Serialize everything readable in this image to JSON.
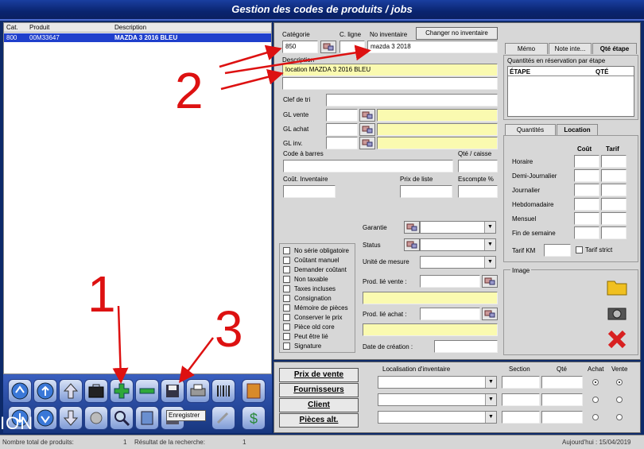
{
  "window": {
    "title": "Gestion des codes de produits / jobs"
  },
  "list": {
    "headers": [
      "Cat.",
      "Produit",
      "Description"
    ],
    "rows": [
      {
        "cat": "800",
        "produit": "00M33647",
        "description": "MAZDA 3 2016 BLEU"
      }
    ]
  },
  "toolbar": {
    "buttons_row1": [
      "nav-first-icon",
      "nav-prev-icon",
      "arrow-up-icon",
      "briefcase-icon",
      "add-icon",
      "remove-icon",
      "save-icon",
      "print-icon",
      "barcode-icon",
      "exit-icon"
    ],
    "buttons_row2": [
      "nav-next-icon",
      "nav-last-icon",
      "arrow-down-icon",
      "attach-icon",
      "search-icon",
      "book-icon",
      "save-disk-icon",
      "tools-icon",
      "money-icon"
    ],
    "save_tooltip": "Enregistrer"
  },
  "overlay_text": "ION",
  "form": {
    "categorie_label": "Catégorie",
    "categorie_value": "850",
    "cligne_label": "C. ligne",
    "noinv_label": "No inventaire",
    "noinv_value": "mazda 3 2018",
    "changer_btn": "Changer no inventaire",
    "description_label": "Description",
    "description_value": "location MAZDA 3 2016 BLEU",
    "clef_label": "Clef de tri",
    "glvente_label": "GL vente",
    "glachat_label": "GL achat",
    "glinv_label": "GL inv.",
    "codebarres_label": "Code à barres",
    "qtecaisse_label": "Qté / caisse",
    "cout_label": "Coût. Inventaire",
    "prixliste_label": "Prix de liste",
    "escompte_label": "Escompte %",
    "garantie_label": "Garantie",
    "status_label": "Status",
    "unite_label": "Unité de mesure",
    "prodvente_label": "Prod. lié vente :",
    "prodachat_label": "Prod. lié achat :",
    "datecreation_label": "Date de création :",
    "checkboxes": [
      "No série obligatoire",
      "Coûtant manuel",
      "Demander coûtant",
      "Non taxable",
      "Taxes incluses",
      "Consignation",
      "Mémoire de pièces",
      "Conserver le prix",
      "Pièce old core",
      "Peut être lié",
      "Signature"
    ]
  },
  "tabs_top": [
    "Mémo",
    "Note inte...",
    "Qté étape"
  ],
  "reservation": {
    "title": "Quantités en réservation par étape",
    "col1": "ÉTAPE",
    "col2": "QTÉ"
  },
  "tabs_mid": [
    "Quantités",
    "Location"
  ],
  "location": {
    "col_cout": "Coût",
    "col_tarif": "Tarif",
    "rows": [
      "Horaire",
      "Demi-Journalier",
      "Journalier",
      "Hebdomadaire",
      "Mensuel",
      "Fin de semaine"
    ],
    "tarif_km": "Tarif KM",
    "tarif_strict": "Tarif strict"
  },
  "image_label": "Image",
  "bottom": {
    "buttons": [
      "Prix de vente",
      "Fournisseurs",
      "Client",
      "Pièces alt."
    ],
    "col_localisation": "Localisation d'inventaire",
    "col_section": "Section",
    "col_qte": "Qté",
    "col_achat": "Achat",
    "col_vente": "Vente"
  },
  "status": {
    "nombre_label": "Nombre total de produits:",
    "nombre_value": "1",
    "resultat_label": "Résultat de la recherche:",
    "resultat_value": "1",
    "date": "Aujourd'hui : 15/04/2019"
  },
  "annotations": {
    "n1": "1",
    "n2": "2",
    "n3": "3"
  },
  "colors": {
    "annotation": "#dd1111",
    "selection": "#1f3fcc",
    "titlebar": "#0a2470",
    "required_field": "#fafab0"
  }
}
